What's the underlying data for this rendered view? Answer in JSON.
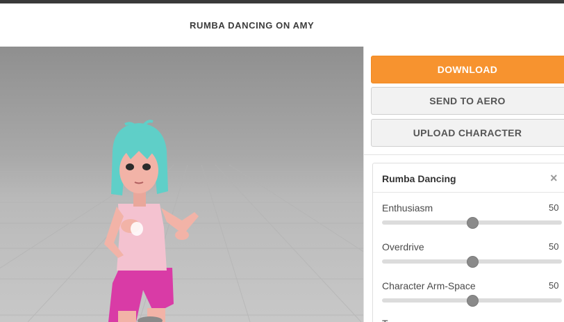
{
  "header": {
    "title": "RUMBA DANCING ON AMY"
  },
  "actions": {
    "download_label": "DOWNLOAD",
    "send_label": "SEND TO AERO",
    "upload_label": "UPLOAD CHARACTER"
  },
  "panel": {
    "title": "Rumba Dancing",
    "close_icon": "×",
    "sliders": [
      {
        "label": "Enthusiasm",
        "value": "50",
        "fraction": 0.5
      },
      {
        "label": "Overdrive",
        "value": "50",
        "fraction": 0.5
      },
      {
        "label": "Character Arm-Space",
        "value": "50",
        "fraction": 0.5
      }
    ],
    "next_label_partial": "T"
  },
  "colors": {
    "accent": "#f7932f",
    "topbar": "#3a3a3a",
    "hair": "#5fcfc8",
    "shirt": "#f4c2d0",
    "shorts": "#d93ba6",
    "skin": "#f2b3a7"
  }
}
